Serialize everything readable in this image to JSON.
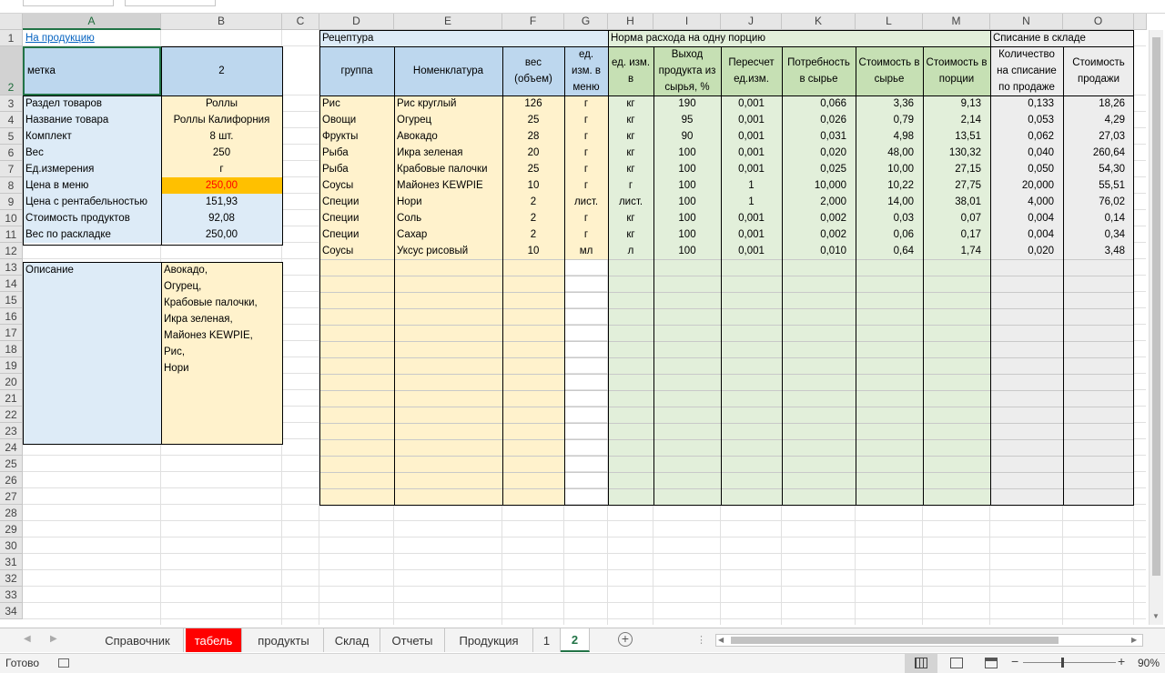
{
  "columns": [
    "A",
    "B",
    "C",
    "D",
    "E",
    "F",
    "G",
    "H",
    "I",
    "J",
    "K",
    "L",
    "M",
    "N",
    "O"
  ],
  "rows": [
    "1",
    "2",
    "3",
    "4",
    "5",
    "6",
    "7",
    "8",
    "9",
    "10",
    "11",
    "12",
    "13",
    "14",
    "15",
    "16",
    "17",
    "18",
    "19",
    "20",
    "21",
    "22",
    "23",
    "24",
    "25",
    "26",
    "27",
    "28",
    "29",
    "30",
    "31",
    "32",
    "33",
    "34"
  ],
  "left": {
    "link": "На продукцию",
    "mark_label": "метка",
    "mark_value": "2",
    "fields": [
      {
        "label": "Раздел товаров",
        "value": "Роллы"
      },
      {
        "label": "Название товара",
        "value": "Роллы Калифорния"
      },
      {
        "label": "Комплект",
        "value": "8 шт."
      },
      {
        "label": "Вес",
        "value": "250"
      },
      {
        "label": "Ед.измерения",
        "value": "г"
      },
      {
        "label": "Цена в меню",
        "value": "250,00"
      },
      {
        "label": "Цена с рентабельностью",
        "value": "151,93"
      },
      {
        "label": "Стоимость продуктов",
        "value": "92,08"
      },
      {
        "label": "Вес по раскладке",
        "value": "250,00"
      }
    ],
    "description_label": "Описание",
    "description_lines": [
      "Авокадо,",
      "Огурец,",
      "Крабовые палочки,",
      "Икра зеленая,",
      "Майонез KEWPIE,",
      "Рис,",
      "Нори"
    ]
  },
  "sections": {
    "recipe": "Рецептура",
    "norm": "Норма расхода на одну порцию",
    "writeoff": "Списание в складе"
  },
  "headers": {
    "D": "группа",
    "E": "Номенклатура",
    "F": "вес (объем)",
    "G": "ед. изм. в меню",
    "H": "ед. изм. в",
    "I": "Выход продукта из сырья, %",
    "J": "Пересчет ед.изм.",
    "K": "Потребность в сырье",
    "L": "Стоимость в сырье",
    "M": "Стоимость в порции",
    "N": "Количество на списание по продаже",
    "O": "Стоимость продажи"
  },
  "table_rows": [
    [
      "Рис",
      "Рис круглый",
      "126",
      "г",
      "кг",
      "190",
      "0,001",
      "0,066",
      "3,36",
      "9,13",
      "0,133",
      "18,26"
    ],
    [
      "Овощи",
      "Огурец",
      "25",
      "г",
      "кг",
      "95",
      "0,001",
      "0,026",
      "0,79",
      "2,14",
      "0,053",
      "4,29"
    ],
    [
      "Фрукты",
      "Авокадо",
      "28",
      "г",
      "кг",
      "90",
      "0,001",
      "0,031",
      "4,98",
      "13,51",
      "0,062",
      "27,03"
    ],
    [
      "Рыба",
      "Икра зеленая",
      "20",
      "г",
      "кг",
      "100",
      "0,001",
      "0,020",
      "48,00",
      "130,32",
      "0,040",
      "260,64"
    ],
    [
      "Рыба",
      "Крабовые палочки",
      "25",
      "г",
      "кг",
      "100",
      "0,001",
      "0,025",
      "10,00",
      "27,15",
      "0,050",
      "54,30"
    ],
    [
      "Соусы",
      "Майонез KEWPIE",
      "10",
      "г",
      "г",
      "100",
      "1",
      "10,000",
      "10,22",
      "27,75",
      "20,000",
      "55,51"
    ],
    [
      "Специи",
      "Нори",
      "2",
      "лист.",
      "лист.",
      "100",
      "1",
      "2,000",
      "14,00",
      "38,01",
      "4,000",
      "76,02"
    ],
    [
      "Специи",
      "Соль",
      "2",
      "г",
      "кг",
      "100",
      "0,001",
      "0,002",
      "0,03",
      "0,07",
      "0,004",
      "0,14"
    ],
    [
      "Специи",
      "Сахар",
      "2",
      "г",
      "кг",
      "100",
      "0,001",
      "0,002",
      "0,06",
      "0,17",
      "0,004",
      "0,34"
    ],
    [
      "Соусы",
      "Уксус рисовый",
      "10",
      "мл",
      "л",
      "100",
      "0,001",
      "0,010",
      "0,64",
      "1,74",
      "0,020",
      "3,48"
    ]
  ],
  "sheets": [
    "Справочник",
    "табель",
    "продукты",
    "Склад",
    "Отчеты",
    "Продукция",
    "1",
    "2"
  ],
  "active_sheet": "2",
  "status": {
    "ready": "Готово",
    "zoom": "90%"
  },
  "add_sheet_symbol": "+",
  "icons": [
    "sheet-prev-icon",
    "sheet-next-icon",
    "add-sheet-icon",
    "normal-view-icon",
    "page-layout-icon",
    "page-break-icon",
    "zoom-out-icon",
    "zoom-in-icon",
    "macro-record-icon"
  ]
}
